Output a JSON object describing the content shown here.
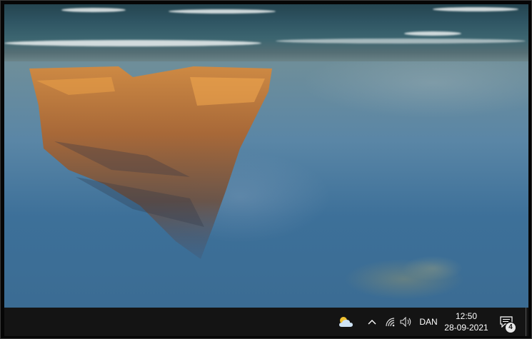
{
  "desktop": {
    "wallpaper": "beach-reflection-wallpaper"
  },
  "taskbar": {
    "weather_icon": "partly-cloudy-icon",
    "overflow_icon": "chevron-up-icon",
    "network_icon": "wifi-icon",
    "volume_icon": "speaker-icon",
    "language": "DAN",
    "time": "12:50",
    "date": "28-09-2021",
    "notifications_icon": "action-center-icon",
    "notification_count": "4"
  }
}
